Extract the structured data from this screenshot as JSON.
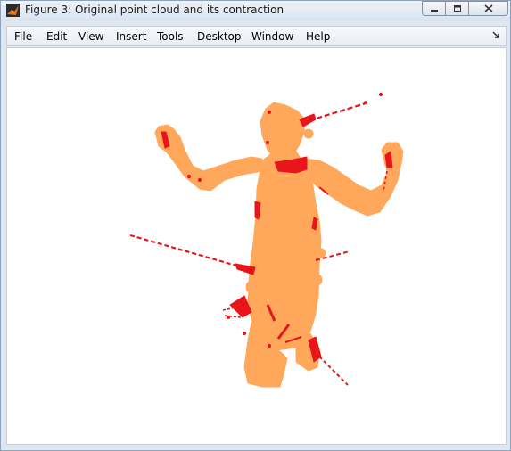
{
  "window": {
    "title": "Figure 3: Original point cloud and its contraction",
    "icon": "matlab-figure-icon"
  },
  "caption_buttons": [
    "minimize-icon",
    "restore-icon",
    "close-icon"
  ],
  "menu": {
    "items": [
      "File",
      "Edit",
      "View",
      "Insert",
      "Tools",
      "Desktop",
      "Window",
      "Help"
    ],
    "dock_icon": "dock-arrow-icon"
  },
  "figure": {
    "colors": {
      "point_cloud": "#ffa85b",
      "contraction": "#e8151a",
      "background": "#ffffff"
    }
  }
}
